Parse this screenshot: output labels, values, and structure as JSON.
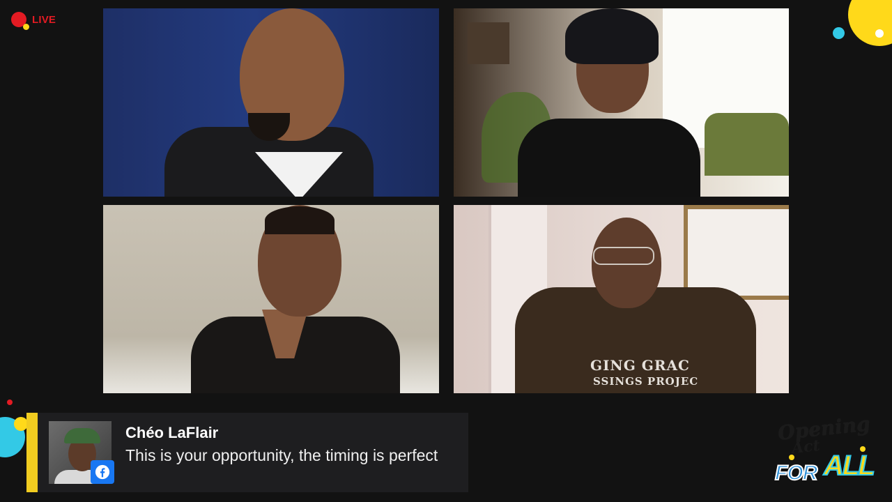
{
  "stream": {
    "live_label": "LIVE"
  },
  "video_tiles": [
    {
      "id": "participant-1"
    },
    {
      "id": "participant-2"
    },
    {
      "id": "participant-3"
    },
    {
      "id": "participant-4",
      "shirt_text_line1": "GING GRAC",
      "shirt_text_line2": "SSINGS PROJEC"
    }
  ],
  "comment": {
    "author": "Chéo LaFlair",
    "message": "This is your opportunity, the timing is perfect",
    "platform_icon": "facebook-icon"
  },
  "logo": {
    "line1": "Opening",
    "line2": "Act",
    "word_for": "FOR",
    "word_all": "ALL"
  },
  "colors": {
    "background": "#121212",
    "live_red": "#e31b23",
    "accent_yellow": "#f1cc20",
    "accent_cyan": "#33c9e6",
    "facebook_blue": "#1877f2"
  }
}
